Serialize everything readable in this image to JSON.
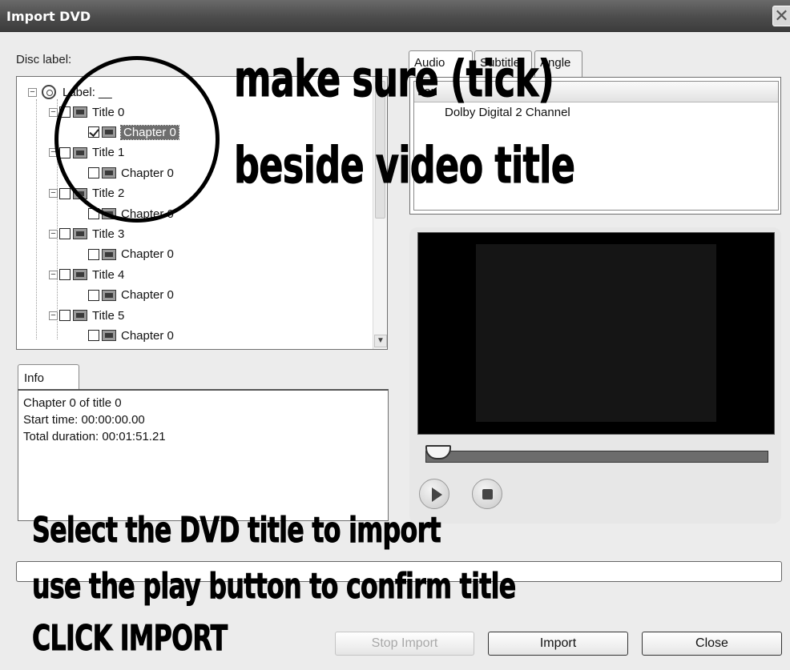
{
  "window": {
    "title": "Import DVD",
    "close_glyph": "✕"
  },
  "disc_label_caption": "Disc label:",
  "tree": {
    "root_label": "Label: __",
    "titles": [
      {
        "label": "Title 0",
        "checked": false,
        "chapter": {
          "label": "Chapter 0",
          "checked": true,
          "selected": true
        }
      },
      {
        "label": "Title 1",
        "checked": false,
        "chapter": {
          "label": "Chapter 0",
          "checked": false
        }
      },
      {
        "label": "Title 2",
        "checked": false,
        "chapter": {
          "label": "Chapter 0",
          "checked": false
        }
      },
      {
        "label": "Title 3",
        "checked": false,
        "chapter": {
          "label": "Chapter 0",
          "checked": false
        }
      },
      {
        "label": "Title 4",
        "checked": false,
        "chapter": {
          "label": "Chapter 0",
          "checked": false
        }
      },
      {
        "label": "Title 5",
        "checked": false,
        "chapter": {
          "label": "Chapter 0",
          "checked": false
        }
      }
    ]
  },
  "info": {
    "tab_label": "Info",
    "lines": [
      "Chapter 0 of title 0",
      "Start time: 00:00:00.00",
      "Total duration: 00:01:51.21"
    ]
  },
  "right_tabs": [
    "Audio",
    "Subtitle",
    "Angle"
  ],
  "audio": {
    "column_header": "Lan",
    "tracks": [
      "Dolby Digital 2 Channel"
    ]
  },
  "player": {
    "seek_position": 0
  },
  "buttons": {
    "stop_import": "Stop Import",
    "import": "Import",
    "close": "Close"
  },
  "annotations": {
    "top_line1": "make sure (tick)",
    "top_line2": "beside video title",
    "bottom_line1": "Select the DVD title to import",
    "bottom_line2": "use the play button to confirm title",
    "bottom_line3": "CLICK IMPORT"
  },
  "colors": {
    "titlebar": "#4c4c4c",
    "selection": "#6e6e6e",
    "video_bg": "#000000"
  }
}
